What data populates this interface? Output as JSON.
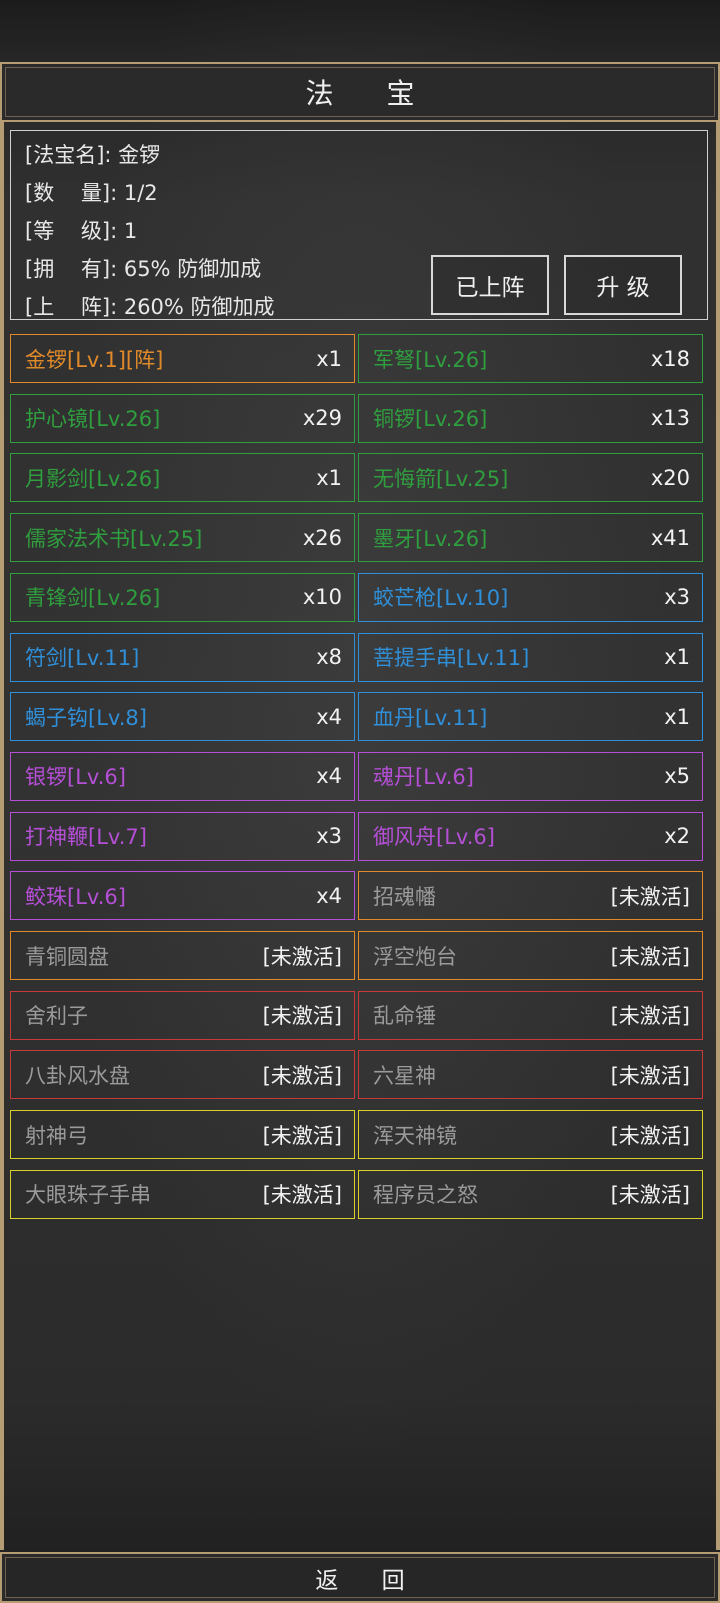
{
  "header": {
    "title": "法 宝"
  },
  "info": {
    "name_line": "[法宝名]: 金锣",
    "quantity_line": "[数    量]: 1/2",
    "level_line": "[等    级]: 1",
    "own_line": "[拥    有]: 65% 防御加成",
    "deploy_line": "[上    阵]: 260% 防御加成"
  },
  "buttons": {
    "deployed": "已上阵",
    "upgrade": "升 级"
  },
  "colors": {
    "orange": "#e08a2a",
    "green": "#2f9e3e",
    "blue": "#2f8fd8",
    "purple": "#b44fd6",
    "red": "#c73a3a",
    "yellow": "#d8cf2a",
    "inactive_text": "#9a9a9a",
    "frame_gold": "#b59c73"
  },
  "items": [
    {
      "name": "金锣[Lv.1][阵]",
      "count": "x1",
      "color": "orange",
      "active": true
    },
    {
      "name": "军弩[Lv.26]",
      "count": "x18",
      "color": "green",
      "active": true
    },
    {
      "name": "护心镜[Lv.26]",
      "count": "x29",
      "color": "green",
      "active": true
    },
    {
      "name": "铜锣[Lv.26]",
      "count": "x13",
      "color": "green",
      "active": true
    },
    {
      "name": "月影剑[Lv.26]",
      "count": "x1",
      "color": "green",
      "active": true
    },
    {
      "name": "无悔箭[Lv.25]",
      "count": "x20",
      "color": "green",
      "active": true
    },
    {
      "name": "儒家法术书[Lv.25]",
      "count": "x26",
      "color": "green",
      "active": true
    },
    {
      "name": "墨牙[Lv.26]",
      "count": "x41",
      "color": "green",
      "active": true
    },
    {
      "name": "青锋剑[Lv.26]",
      "count": "x10",
      "color": "green",
      "active": true
    },
    {
      "name": "蛟芒枪[Lv.10]",
      "count": "x3",
      "color": "blue",
      "active": true
    },
    {
      "name": "符剑[Lv.11]",
      "count": "x8",
      "color": "blue",
      "active": true
    },
    {
      "name": "菩提手串[Lv.11]",
      "count": "x1",
      "color": "blue",
      "active": true
    },
    {
      "name": "蝎子钩[Lv.8]",
      "count": "x4",
      "color": "blue",
      "active": true
    },
    {
      "name": "血丹[Lv.11]",
      "count": "x1",
      "color": "blue",
      "active": true
    },
    {
      "name": "银锣[Lv.6]",
      "count": "x4",
      "color": "purple",
      "active": true
    },
    {
      "name": "魂丹[Lv.6]",
      "count": "x5",
      "color": "purple",
      "active": true
    },
    {
      "name": "打神鞭[Lv.7]",
      "count": "x3",
      "color": "purple",
      "active": true
    },
    {
      "name": "御风舟[Lv.6]",
      "count": "x2",
      "color": "purple",
      "active": true
    },
    {
      "name": "鲛珠[Lv.6]",
      "count": "x4",
      "color": "purple",
      "active": true
    },
    {
      "name": "招魂幡",
      "count": "[未激活]",
      "color": "orange",
      "active": false
    },
    {
      "name": "青铜圆盘",
      "count": "[未激活]",
      "color": "orange",
      "active": false
    },
    {
      "name": "浮空炮台",
      "count": "[未激活]",
      "color": "orange",
      "active": false
    },
    {
      "name": "舍利子",
      "count": "[未激活]",
      "color": "red",
      "active": false
    },
    {
      "name": "乱命锤",
      "count": "[未激活]",
      "color": "red",
      "active": false
    },
    {
      "name": "八卦风水盘",
      "count": "[未激活]",
      "color": "red",
      "active": false
    },
    {
      "name": "六星神",
      "count": "[未激活]",
      "color": "red",
      "active": false
    },
    {
      "name": "射神弓",
      "count": "[未激活]",
      "color": "yellow",
      "active": false
    },
    {
      "name": "浑天神镜",
      "count": "[未激活]",
      "color": "yellow",
      "active": false
    },
    {
      "name": "大眼珠子手串",
      "count": "[未激活]",
      "color": "yellow",
      "active": false
    },
    {
      "name": "程序员之怒",
      "count": "[未激活]",
      "color": "yellow",
      "active": false
    }
  ],
  "footer": {
    "back": "返 回"
  }
}
